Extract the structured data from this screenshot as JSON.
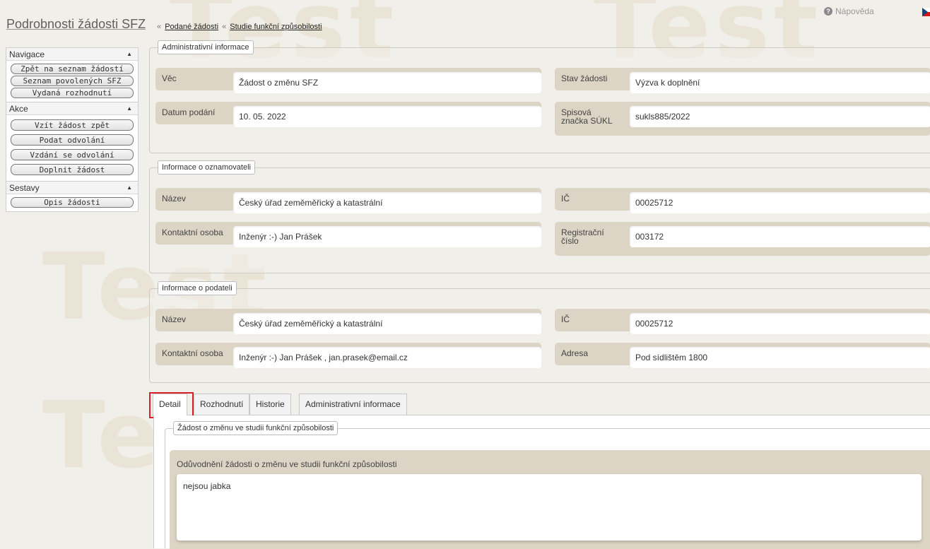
{
  "header": {
    "title": "Podrobnosti žádosti SFZ",
    "separator": "«",
    "breadcrumb": [
      "Podané žádosti",
      "Studie funkční způsobilosti"
    ],
    "help_label": "Nápověda"
  },
  "watermark": "Test",
  "sidebar": {
    "sections": [
      {
        "title": "Navigace",
        "items": [
          "Zpět na seznam žádostí",
          "Seznam povolených SFZ",
          "Vydaná rozhodnutí"
        ]
      },
      {
        "title": "Akce",
        "items": [
          "Vzít žádost zpět",
          "Podat odvolání",
          "Vzdání se odvolání",
          "Doplnit žádost"
        ]
      },
      {
        "title": "Sestavy",
        "items": [
          "Opis žádosti"
        ]
      }
    ]
  },
  "admin_info": {
    "legend": "Administrativní informace",
    "vec_label": "Věc",
    "vec_value": "Žádost o změnu SFZ",
    "stav_label": "Stav žádosti",
    "stav_value": "Výzva k doplnění",
    "datum_label": "Datum podání",
    "datum_value": "10. 05. 2022",
    "spis_label": "Spisová značka SÚKL",
    "spis_value": "sukls885/2022"
  },
  "oznamovatel": {
    "legend": "Informace o oznamovateli",
    "nazev_label": "Název",
    "nazev_value": "Český úřad zeměměřický a katastrální",
    "ic_label": "IČ",
    "ic_value": "00025712",
    "kontakt_label": "Kontaktní osoba",
    "kontakt_value": "Inženýr :-) Jan Prášek",
    "reg_label": "Registrační číslo",
    "reg_value": "003172"
  },
  "podatel": {
    "legend": "Informace o podateli",
    "nazev_label": "Název",
    "nazev_value": "Český úřad zeměměřický a katastrální",
    "ic_label": "IČ",
    "ic_value": "00025712",
    "kontakt_label": "Kontaktní osoba",
    "kontakt_value": "Inženýr :-) Jan Prášek , jan.prasek@email.cz",
    "adresa_label": "Adresa",
    "adresa_value": "Pod sídlištěm 1800"
  },
  "tabs": [
    "Detail",
    "Rozhodnutí",
    "Historie",
    "Administrativní informace"
  ],
  "detail": {
    "legend": "Žádost o změnu ve studii funkční způsobilosti",
    "reason_label": "Odůvodnění žádosti o změnu ve studii funkční způsobilosti",
    "reason_value": "nejsou jabka"
  },
  "colors": {
    "highlight": "#d81f2b",
    "field_bg": "#dcd4c4",
    "page_bg": "#f1efea"
  }
}
